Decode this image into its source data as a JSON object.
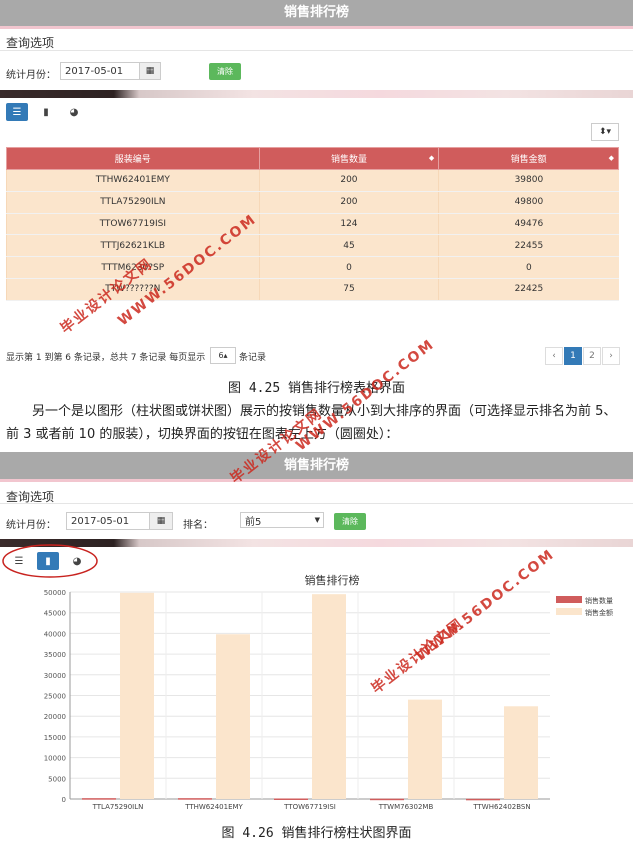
{
  "screen1": {
    "title": "销售排行榜",
    "query_heading": "查询选项",
    "month_label": "统计月份：",
    "month_value": "2017-05-01",
    "clear_label": "清除",
    "table": {
      "headers": [
        "服装编号",
        "销售数量",
        "销售金额"
      ],
      "rows": [
        [
          "TTHW62401EMY",
          "200",
          "39800"
        ],
        [
          "TTLA75290ILN",
          "200",
          "49800"
        ],
        [
          "TTOW67719ISI",
          "124",
          "49476"
        ],
        [
          "TTTJ62621KLB",
          "45",
          "22455"
        ],
        [
          "TTTM6230?SP",
          "0",
          "0"
        ],
        [
          "TTW??????N",
          "75",
          "22425"
        ]
      ]
    },
    "pager_text_before": "显示第 1 到第 6 条记录，总共 7 条记录 每页显示",
    "page_size": "6",
    "pager_text_after": "条记录",
    "pages": [
      "‹",
      "1",
      "2",
      "›"
    ]
  },
  "caption1": "图 4.25 销售排行榜表格界面",
  "paragraph": "另一个是以图形（柱状图或饼状图）展示的按销售数量从小到大排序的界面（可选择显示排名为前 5、前 3 或者前 10 的服装），切换界面的按钮在图表左上方（圆圈处）：",
  "screen2": {
    "title": "销售排行榜",
    "query_heading": "查询选项",
    "month_label": "统计月份：",
    "month_value": "2017-05-01",
    "rank_label": "排名：",
    "rank_value": "前5",
    "clear_label": "清除"
  },
  "caption2": "图 4.26 销售排行榜柱状图界面",
  "watermarks": [
    "WWW.56DOC.COM",
    "毕业设计论文网"
  ],
  "colors": {
    "header_red": "#d05c5c",
    "row_bg": "#fbe5cc",
    "active_blue": "#337ab7",
    "clear_green": "#5cb85c",
    "series_qty": "#d05c5c",
    "series_amt": "#fbe5cc"
  },
  "icons": {
    "calendar": "calendar-icon",
    "list_view": "list-icon",
    "bar_view": "bar-chart-icon",
    "pie_view": "pie-chart-icon",
    "export": "export-icon"
  },
  "chart_data": {
    "type": "bar",
    "title": "销售排行榜",
    "categories": [
      "TTLA75290ILN",
      "TTHW62401EMY",
      "TTOW67719ISI",
      "TTWM76302MB",
      "TTWH62402BSN"
    ],
    "series": [
      {
        "name": "销售数量",
        "values": [
          200,
          200,
          124,
          75,
          45
        ]
      },
      {
        "name": "销售金额",
        "values": [
          49800,
          39800,
          49476,
          24000,
          22400
        ]
      }
    ],
    "ylim": [
      0,
      50000
    ],
    "yticks": [
      0,
      5000,
      10000,
      15000,
      20000,
      25000,
      30000,
      35000,
      40000,
      45000,
      50000
    ],
    "grid": true,
    "legend": "top-right"
  }
}
